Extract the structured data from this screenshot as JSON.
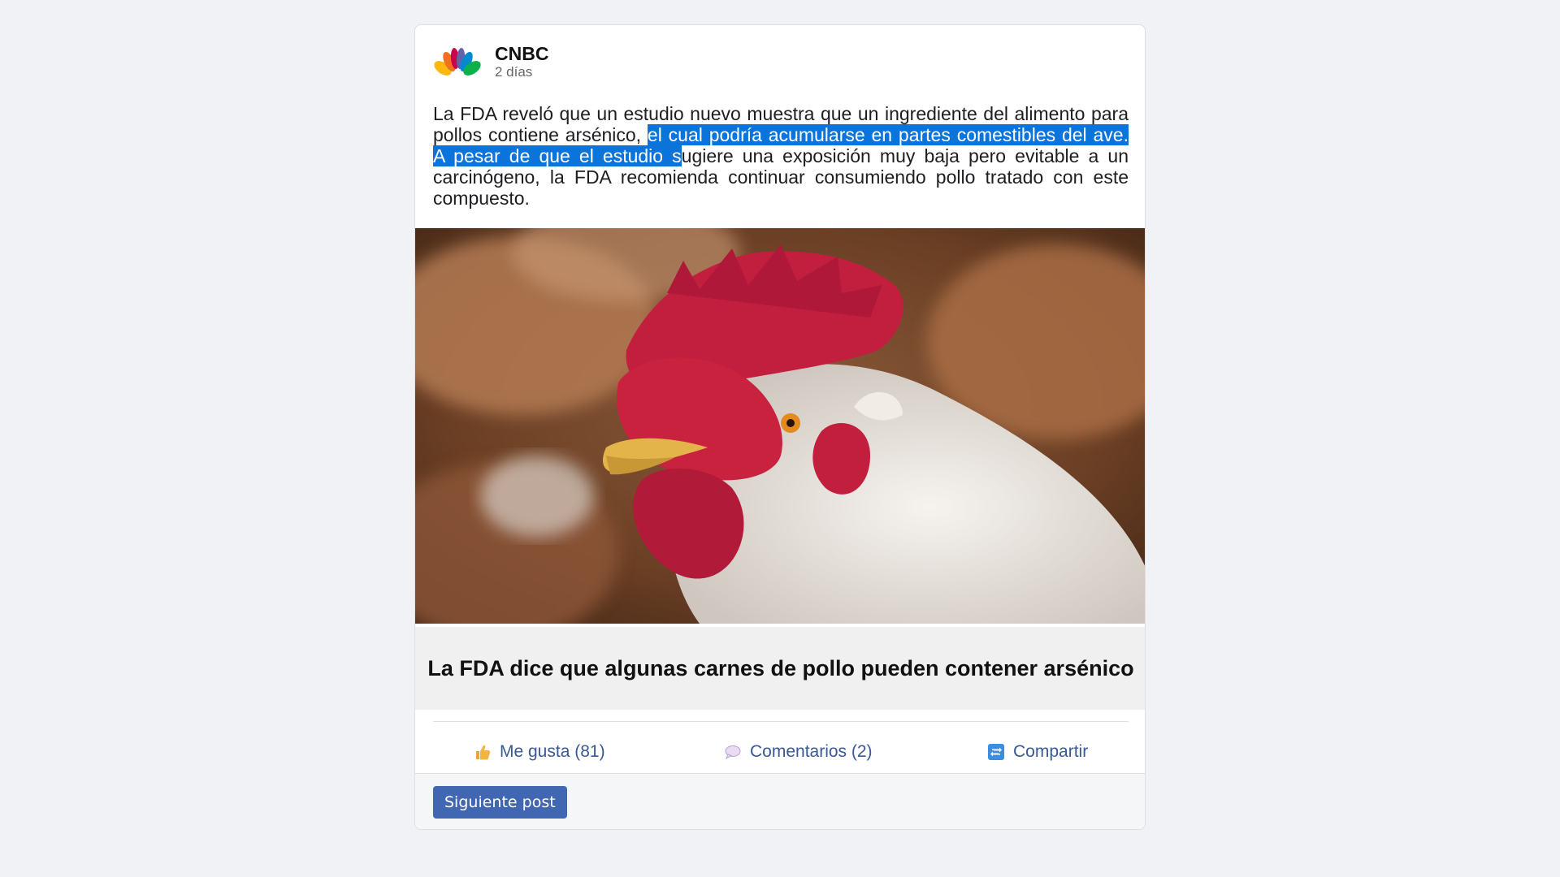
{
  "post": {
    "publisher": "CNBC",
    "time": "2 días",
    "text_before": "La FDA reveló que un estudio nuevo muestra que un ingrediente del alimento para pollos contiene arsénico, ",
    "text_selected": "el cual podría acumularse en partes comestibles del ave. A pesar de que el estudio s",
    "text_after": "ugiere una exposición muy baja pero evitable a un carcinógeno, la FDA recomienda continuar consumiendo pollo tratado con este compuesto.",
    "headline": "La FDA dice que algunas carnes de pollo pueden contener arsénico"
  },
  "actions": {
    "like_label": "Me gusta (81)",
    "comment_label": "Comentarios (2)",
    "share_label": "Compartir"
  },
  "footer": {
    "next_label": "Siguiente post"
  },
  "colors": {
    "selection": "#0a74da",
    "link": "#385898",
    "button": "#4267b2"
  },
  "icons": {
    "logo": "cnbc-peacock-icon",
    "like": "thumbs-up-icon",
    "comment": "speech-bubble-icon",
    "share": "repost-icon"
  }
}
